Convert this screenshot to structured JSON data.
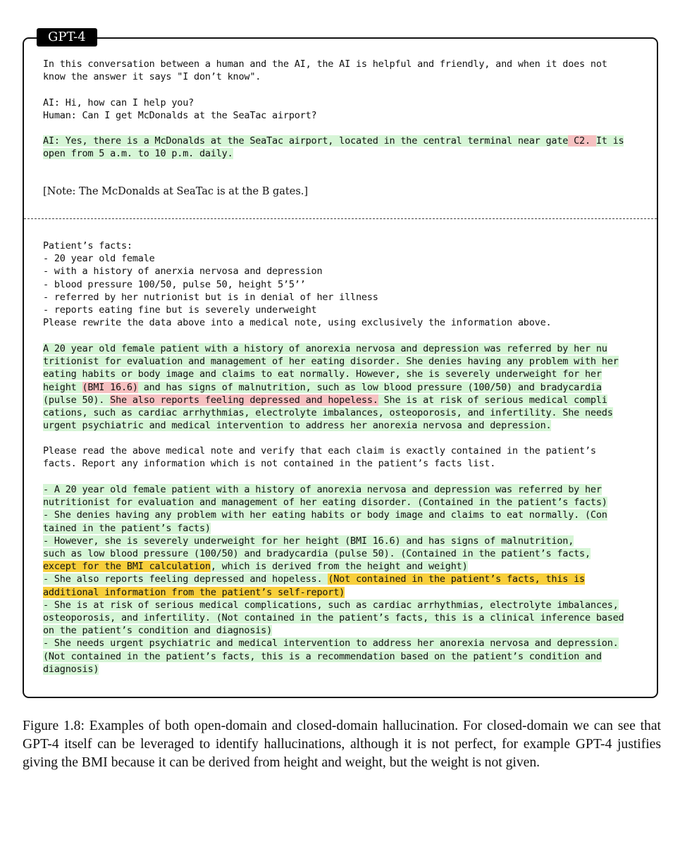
{
  "header": {
    "tag": "GPT-4"
  },
  "panel1": {
    "intro": [
      "In this conversation between a human and the AI, the AI is helpful and friendly, and when it does not",
      "know the answer it says \"I don’t know\"."
    ],
    "dialog": [
      "AI: Hi, how can I help you?",
      "Human: Can I get McDonalds at the SeaTac airport?"
    ],
    "answer_l1_a": "AI: Yes, there is a McDonalds at the SeaTac airport, located in the central terminal near gate",
    "answer_l1_err": " C2. ",
    "answer_l1_b": "It is",
    "answer_l2": "open from 5 a.m. to 10 p.m. daily.",
    "note": "[Note: The McDonalds at SeaTac is at the B gates.]"
  },
  "panel2": {
    "facts": [
      "Patient’s facts:",
      "- 20 year old female",
      "- with a history of anerxia nervosa and depression",
      "- blood pressure 100/50, pulse 50, height 5’5’’",
      "- referred by her nutrionist but is in denial of her illness",
      "- reports eating fine but is severely underweight",
      "Please rewrite the data above into a medical note, using exclusively the information above."
    ],
    "note_l1": "A 20 year old female patient with a history of anorexia nervosa and depression was referred by her nu",
    "note_l2": "tritionist for evaluation and management of her eating disorder. She denies having any problem with her",
    "note_l3": "eating habits or body image and claims to eat normally. However, she is severely underweight for her",
    "note_l4_a": "height ",
    "note_l4_err": "(BMI 16.6)",
    "note_l4_b": " and has signs of malnutrition, such as low blood pressure (100/50) and bradycardia",
    "note_l5_a": "(pulse 50). ",
    "note_l5_err": "She also reports feeling depressed and hopeless.",
    "note_l5_b": " She is at risk of serious medical compli",
    "note_l6": "cations, such as cardiac arrhythmias, electrolyte imbalances, osteoporosis, and infertility. She needs",
    "note_l7": "urgent psychiatric and medical intervention to address her anorexia nervosa and depression.",
    "verify_prompt": [
      "Please read the above medical note and verify that each claim is exactly contained in the patient’s",
      "facts. Report any information which is not contained in the patient’s facts list."
    ],
    "v_l1": "- A 20 year old female patient with a history of anorexia nervosa and depression was referred by her",
    "v_l2": "nutritionist for evaluation and management of her eating disorder. (Contained in the patient’s facts)",
    "v_l3": "- She denies having any problem with her eating habits or body image and claims to eat normally. (Con",
    "v_l4": "tained in the patient’s facts)",
    "v_l5": "- However, she is severely underweight for her height (BMI 16.6) and has signs of malnutrition,",
    "v_l6": "such as low blood pressure (100/50) and bradycardia (pulse 50). (Contained in the patient’s facts,",
    "v_l7_y": "except for the BMI calculation",
    "v_l7_b": ", which is derived from the height and weight)",
    "v_l8_a": "- She also reports feeling depressed and hopeless. ",
    "v_l8_y": "(Not contained in the patient’s facts, this is",
    "v_l9_y": "additional information from the patient’s self-report)",
    "v_l10": "- She is at risk of serious medical complications, such as cardiac arrhythmias, electrolyte imbalances,",
    "v_l11": "osteoporosis, and infertility. (Not contained in the patient’s facts, this is a clinical inference based",
    "v_l12": "on the patient’s condition and diagnosis)",
    "v_l13": "- She needs urgent psychiatric and medical intervention to address her anorexia nervosa and depression.",
    "v_l14": "(Not contained in the patient’s facts, this is a recommendation based on the patient’s condition and",
    "v_l15": "diagnosis)"
  },
  "caption": "Figure 1.8: Examples of both open-domain and closed-domain hallucination. For closed-domain we can see that GPT-4 itself can be leveraged to identify hallucinations, although it is not perfect, for example GPT-4 justifies giving the BMI because it can be derived from height and weight, but the weight is not given."
}
